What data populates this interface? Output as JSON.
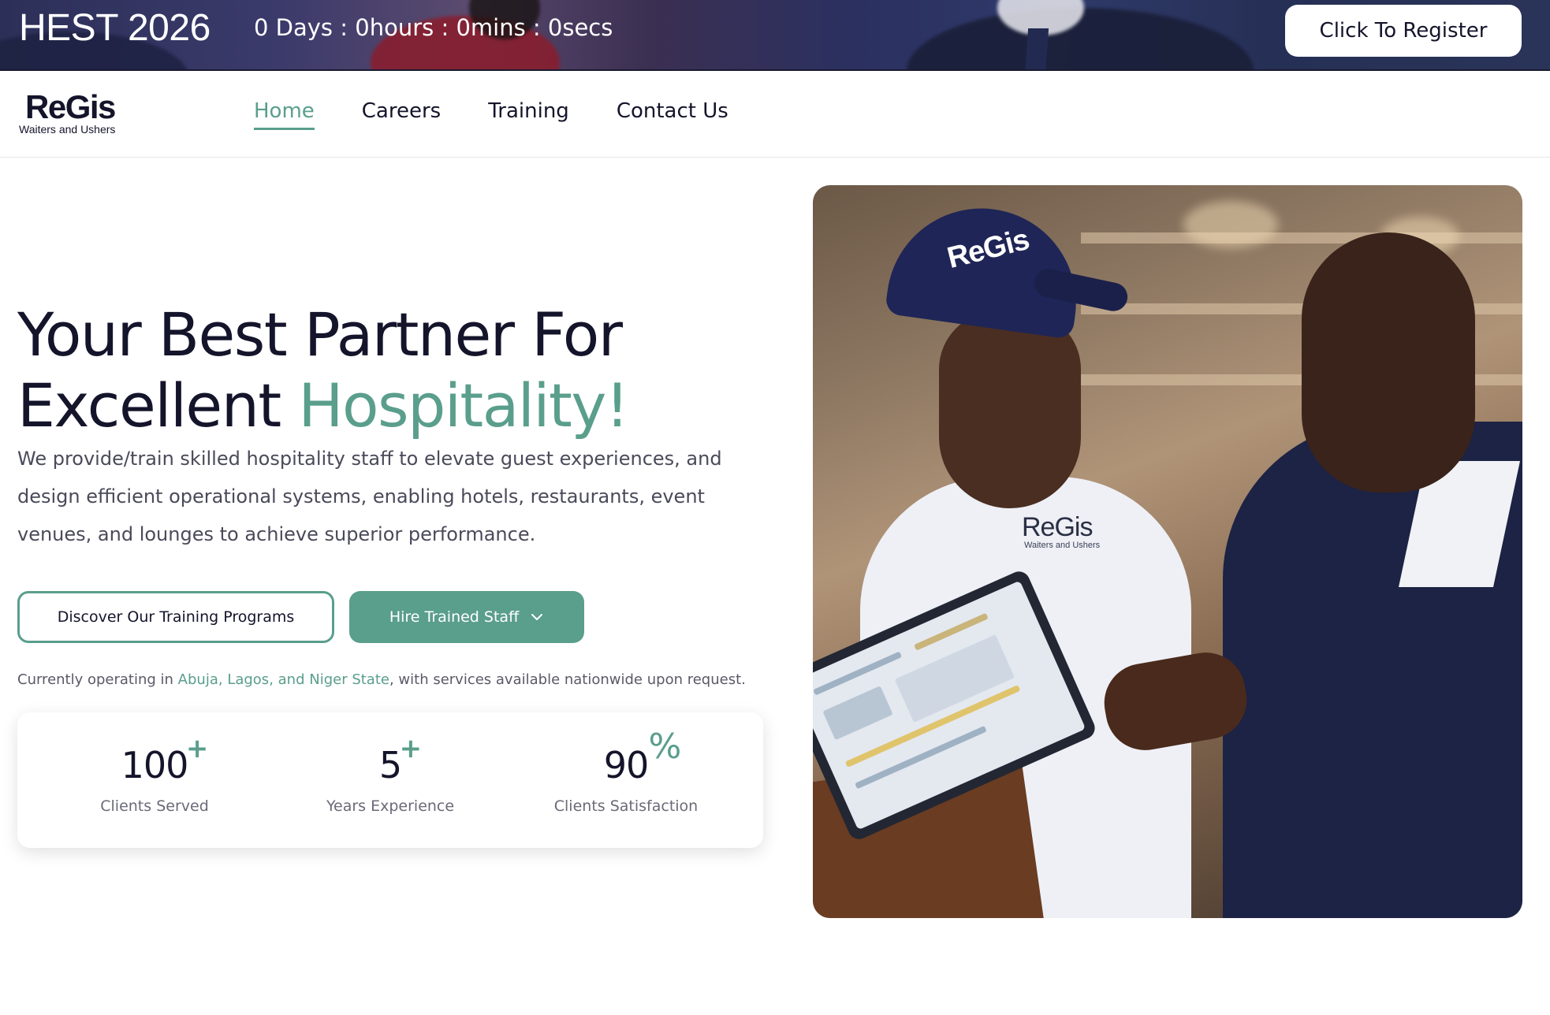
{
  "topbar": {
    "event_title": "HEST 2026",
    "countdown": "0 Days : 0hours : 0mins : 0secs",
    "register_label": "Click To Register"
  },
  "navbar": {
    "logo_word": "ReGis",
    "logo_sub": "Waiters and Ushers",
    "links": [
      {
        "label": "Home",
        "active": true
      },
      {
        "label": "Careers",
        "active": false
      },
      {
        "label": "Training",
        "active": false
      },
      {
        "label": "Contact Us",
        "active": false
      }
    ]
  },
  "hero": {
    "title_line1": "Your Best Partner For",
    "title_line2_plain": "Excellent ",
    "title_line2_accent": "Hospitality!",
    "description": "We provide/train skilled hospitality staff to elevate guest experiences, and design efficient operational systems, enabling hotels, restaurants, event venues, and lounges to achieve superior performance.",
    "btn_training": "Discover Our Training Programs",
    "btn_hire": "Hire Trained Staff",
    "operating_prefix": "Currently operating in ",
    "operating_abuja": "Abuja",
    "operating_comma1": ", ",
    "operating_lagos": "Lagos",
    "operating_comma2": ", ",
    "operating_niger": "and Niger State",
    "operating_suffix": ", with services available nationwide upon request."
  },
  "stats": [
    {
      "value": "100",
      "suffix": "+",
      "label": "Clients Served"
    },
    {
      "value": "5",
      "suffix": "+",
      "label": "Years Experience"
    },
    {
      "value": "90",
      "suffix": "%",
      "label": "Clients Satisfaction"
    }
  ],
  "hero_image": {
    "cap_logo": "ReGis",
    "shirt_logo": "ReGis",
    "shirt_sub": "Waiters and Ushers"
  },
  "colors": {
    "accent": "#5a9e8c",
    "text_dark": "#14142b",
    "text_muted": "#4a4a5a"
  },
  "icons": {
    "hire_dropdown": "chevron-down-icon"
  }
}
